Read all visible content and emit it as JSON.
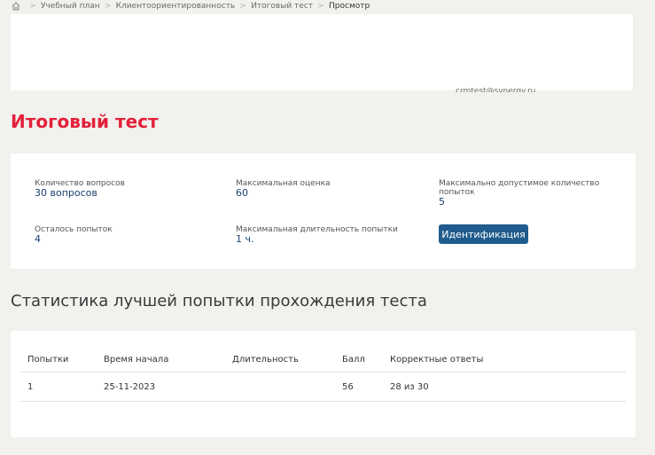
{
  "breadcrumb": {
    "items": [
      "Учебный план",
      "Клиентоориентированность",
      "Итоговый тест"
    ],
    "current": "Просмотр"
  },
  "header_cut_text": "crmtest@synergy.ru",
  "page_title": "Итоговый тест",
  "info": {
    "questions": {
      "label": "Количество вопросов",
      "value": "30 вопросов"
    },
    "max_score": {
      "label": "Максимальная оценка",
      "value": "60"
    },
    "max_attempts": {
      "label": "Максимально допустимое количество попыток",
      "value": "5"
    },
    "attempts_left": {
      "label": "Осталось попыток",
      "value": "4"
    },
    "max_duration": {
      "label": "Максимальная длительность попытки",
      "value": "1 ч."
    },
    "identify_button": "Идентификация"
  },
  "stats": {
    "title": "Статистика лучшей попытки прохождения теста",
    "columns": [
      "Попытки",
      "Время начала",
      "Длительность",
      "Балл",
      "Корректные ответы"
    ],
    "rows": [
      [
        "1",
        "25-11-2023",
        "",
        "56",
        "28 из 30"
      ]
    ]
  }
}
